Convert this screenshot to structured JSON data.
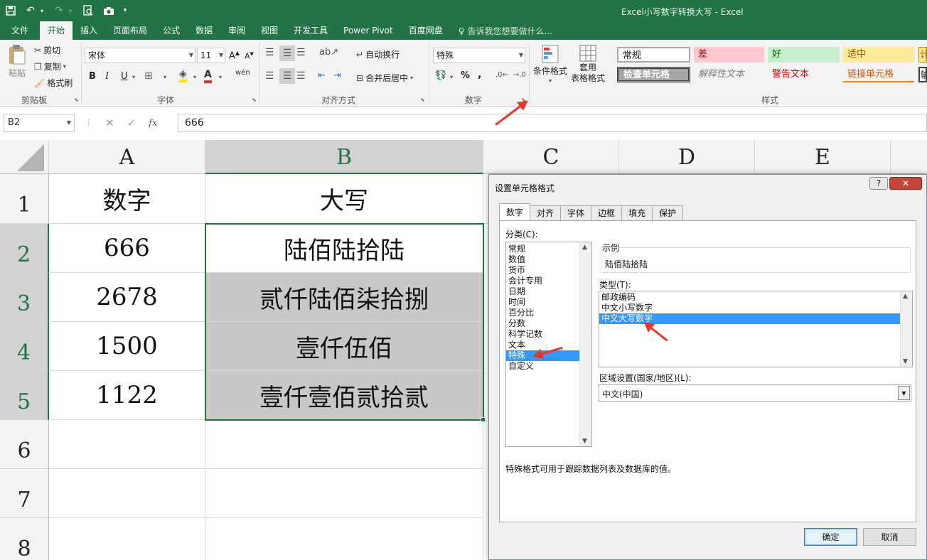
{
  "window": {
    "title": "Excel小写数字转换大写 - Excel"
  },
  "tabs": [
    "文件",
    "开始",
    "插入",
    "页面布局",
    "公式",
    "数据",
    "审阅",
    "视图",
    "开发工具",
    "Power Pivot",
    "百度网盘"
  ],
  "tell_me": "告诉我您想要做什么...",
  "ribbon": {
    "clipboard": {
      "paste": "粘贴",
      "cut": "剪切",
      "copy": "复制",
      "format_painter": "格式刷",
      "label": "剪贴板"
    },
    "font": {
      "name": "宋体",
      "size": "11",
      "label": "字体",
      "bold": "B",
      "italic": "I",
      "underline": "U",
      "font_color": "A",
      "wen": "wén"
    },
    "alignment": {
      "wrap": "自动换行",
      "merge": "合并后居中",
      "label": "对齐方式"
    },
    "number": {
      "format": "特殊",
      "percent": "%",
      "comma": ",",
      "label": "数字"
    },
    "styles": {
      "conditional": "条件格式",
      "table_format_1": "套用",
      "table_format_2": "表格格式",
      "normal": "常规",
      "bad": "差",
      "good": "好",
      "neutral": "适中",
      "check_cell": "检查单元格",
      "explanatory": "解释性文本",
      "warning": "警告文本",
      "linked": "链接单元格",
      "label": "样式"
    }
  },
  "formula_bar": {
    "name_box": "B2",
    "fx": "fx",
    "value": "666"
  },
  "sheet": {
    "columns": [
      "A",
      "B",
      "C",
      "D",
      "E"
    ],
    "rows": [
      "1",
      "2",
      "3",
      "4",
      "5",
      "6",
      "7",
      "8"
    ],
    "cells": [
      {
        "a": "数字",
        "b": "大写"
      },
      {
        "a": "666",
        "b": "陆佰陆拾陆"
      },
      {
        "a": "2678",
        "b": "贰仟陆佰柒拾捌"
      },
      {
        "a": "1500",
        "b": "壹仟伍佰"
      },
      {
        "a": "1122",
        "b": "壹仟壹佰贰拾贰"
      }
    ]
  },
  "dialog": {
    "title": "设置单元格格式",
    "help": "?",
    "close": "✕",
    "tabs": [
      "数字",
      "对齐",
      "字体",
      "边框",
      "填充",
      "保护"
    ],
    "category_label": "分类(C):",
    "categories": [
      "常规",
      "数值",
      "货币",
      "会计专用",
      "日期",
      "时间",
      "百分比",
      "分数",
      "科学记数",
      "文本",
      "特殊",
      "自定义"
    ],
    "selected_category": "特殊",
    "sample_label": "示例",
    "sample_value": "陆佰陆拾陆",
    "type_label": "类型(T):",
    "types": [
      "邮政编码",
      "中文小写数字",
      "中文大写数字"
    ],
    "selected_type": "中文大写数字",
    "locale_label": "区域设置(国家/地区)(L):",
    "locale_value": "中文(中国)",
    "description": "特殊格式可用于跟踪数据列表及数据库的值。",
    "ok": "确定",
    "cancel": "取消"
  },
  "colors": {
    "excel_green": "#217346",
    "selection_blue": "#3399ff",
    "annotation_red": "#e8362d",
    "bad_bg": "#ffc7ce",
    "good_bg": "#c6efce",
    "neutral_bg": "#ffeb9c"
  }
}
